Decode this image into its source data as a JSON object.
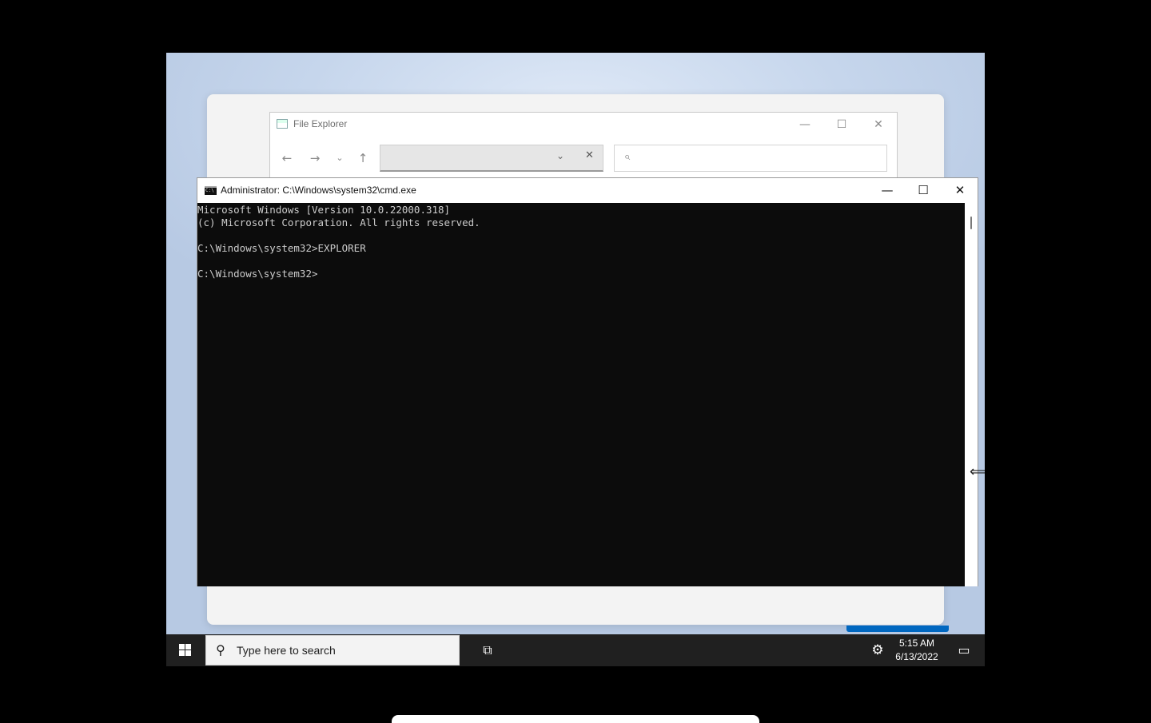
{
  "file_explorer": {
    "title": "File Explorer",
    "minimize": "—",
    "maximize": "☐",
    "close": "✕",
    "nav": {
      "back": "←",
      "forward": "→",
      "recent": "⌄",
      "up": "↑"
    },
    "address": {
      "value": "",
      "dropdown": "⌄",
      "clear": "✕"
    },
    "search": {
      "icon": "search-icon",
      "glyph": "⌕",
      "placeholder": ""
    }
  },
  "cmd": {
    "title": "Administrator: C:\\Windows\\system32\\cmd.exe",
    "icon_text": "C:\\",
    "minimize": "—",
    "maximize": "☐",
    "close": "✕",
    "console_lines": [
      "Microsoft Windows [Version 10.0.22000.318]",
      "(c) Microsoft Corporation. All rights reserved.",
      "",
      "C:\\Windows\\system32>EXPLORER",
      "",
      "C:\\Windows\\system32>"
    ],
    "cursor_glyph": "⟺"
  },
  "taskbar": {
    "search_placeholder": "Type here to search",
    "search_glyph": "⚲",
    "taskview_glyph": "⧉",
    "settings_glyph": "⚙",
    "time": "5:15 AM",
    "date": "6/13/2022",
    "notifications_glyph": "▭"
  },
  "colors": {
    "accent": "#0067c0",
    "taskbar": "#202020",
    "console_bg": "#0c0c0c",
    "console_fg": "#cccccc"
  }
}
